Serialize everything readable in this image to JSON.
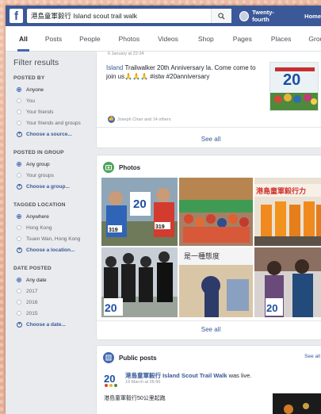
{
  "topbar": {
    "search_value": "港島童軍毅行 Island scout trail walk",
    "profile_name": "Twenty-fourth",
    "home_label": "Home"
  },
  "tabs": [
    {
      "label": "All"
    },
    {
      "label": "Posts"
    },
    {
      "label": "People"
    },
    {
      "label": "Photos"
    },
    {
      "label": "Videos"
    },
    {
      "label": "Shop"
    },
    {
      "label": "Pages"
    },
    {
      "label": "Places"
    },
    {
      "label": "Groups"
    }
  ],
  "sidebar": {
    "title": "Filter results",
    "sections": [
      {
        "heading": "POSTED BY",
        "options": [
          "Anyone",
          "You",
          "Your friends",
          "Your friends and groups"
        ],
        "selected": 0,
        "choose": "Choose a source..."
      },
      {
        "heading": "POSTED IN GROUP",
        "options": [
          "Any group",
          "Your groups"
        ],
        "selected": 0,
        "choose": "Choose a group..."
      },
      {
        "heading": "TAGGED LOCATION",
        "options": [
          "Anywhere",
          "Hong Kong",
          "Tsuen Wan, Hong Kong"
        ],
        "selected": 0,
        "choose": "Choose a location..."
      },
      {
        "heading": "DATE POSTED",
        "options": [
          "Any date",
          "2017",
          "2016",
          "2015"
        ],
        "selected": 0,
        "choose": "Choose a date..."
      }
    ]
  },
  "post1": {
    "date": "6 January at 22:34",
    "text_tag": "Island",
    "text": " Trailwalker 20th Anniversary la. Come come to join us🙏🙏🙏 #istw #20anniversary",
    "reactions": "Joseph Chan and 14 others",
    "see_all": "See all"
  },
  "photos": {
    "heading": "Photos",
    "see_all": "See all",
    "caption_text": "是一種態度"
  },
  "public_posts": {
    "heading": "Public posts",
    "see_all": "See all",
    "author": "港島童軍毅行 Island Scout Trail Walk",
    "action": " was live.",
    "time": "19 March at 05:56",
    "text": "港島童軍毅行50公里起跑"
  },
  "colors": {
    "brand": "#3b5998",
    "link": "#365899",
    "tab_active": "#4267b2"
  }
}
